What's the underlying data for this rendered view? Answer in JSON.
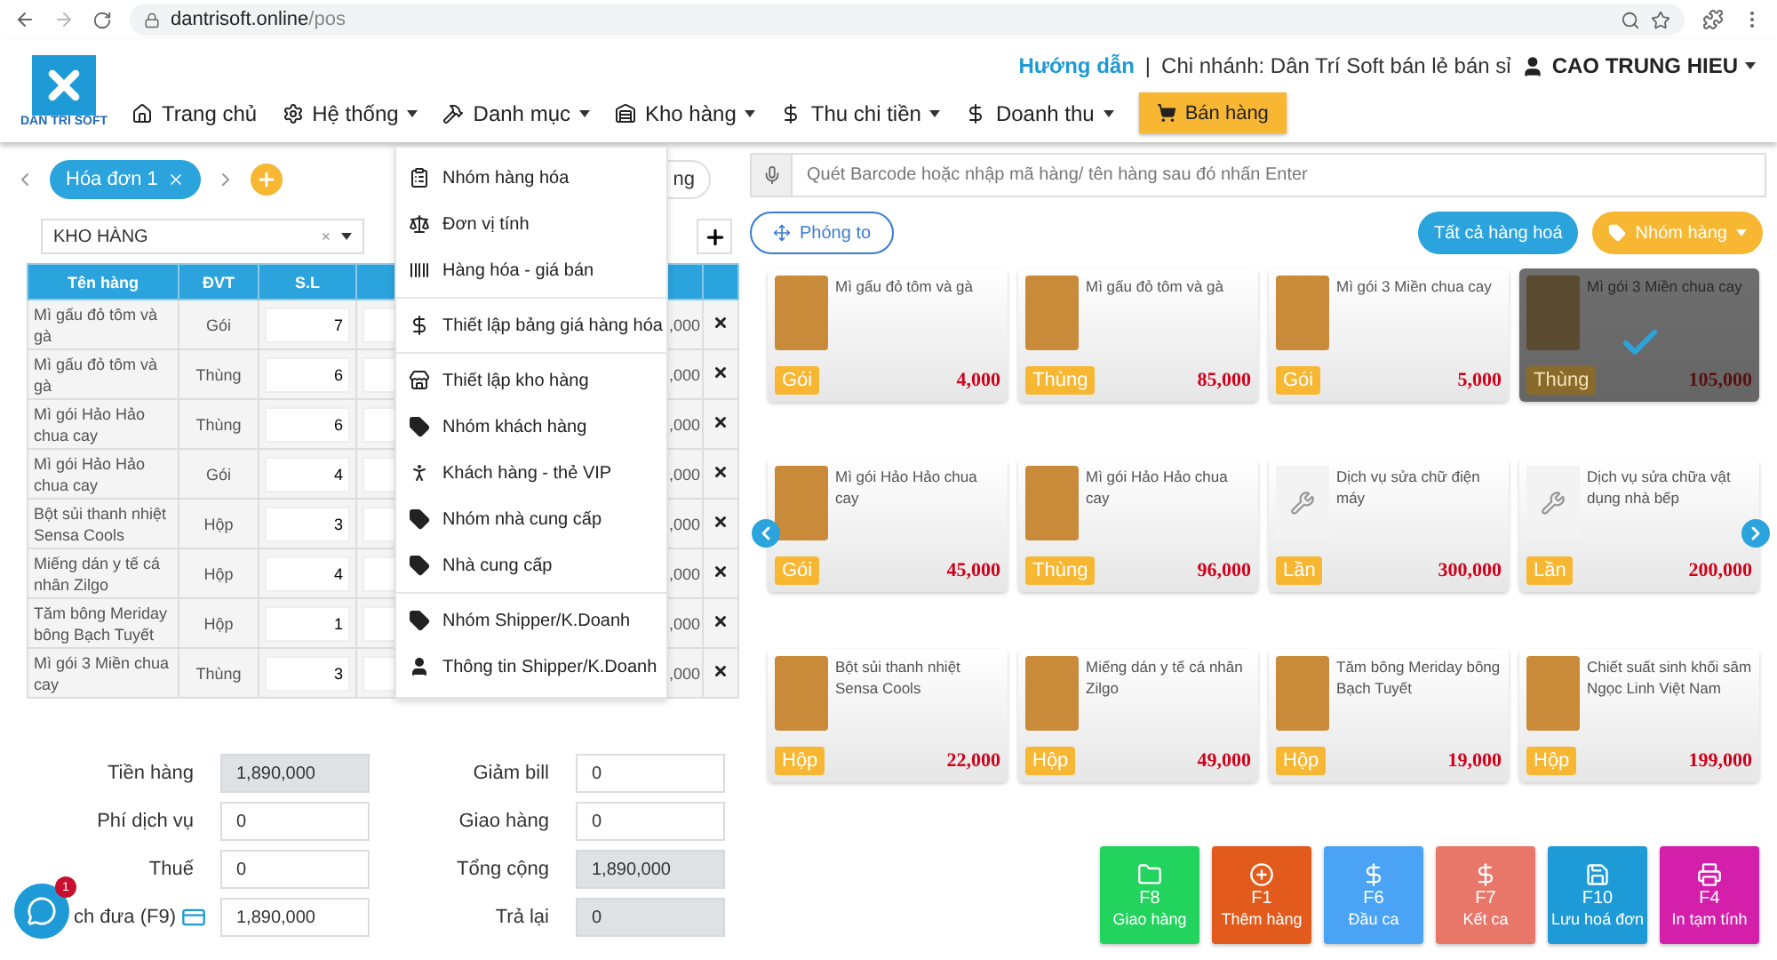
{
  "browser": {
    "url_host": "dantrisoft.online",
    "url_path": "/pos"
  },
  "header": {
    "logo_text": "DAN TRI SOFT",
    "guide_link": "Hướng dẫn",
    "separator": "|",
    "branch": "Chi nhánh: Dân Trí Soft bán lẻ bán sỉ",
    "user": "CAO TRUNG HIEU",
    "nav": [
      {
        "label": "Trang chủ",
        "dropdown": false
      },
      {
        "label": "Hệ thống",
        "dropdown": true
      },
      {
        "label": "Danh mục",
        "dropdown": true
      },
      {
        "label": "Kho hàng",
        "dropdown": true
      },
      {
        "label": "Thu chi tiền",
        "dropdown": true
      },
      {
        "label": "Doanh thu",
        "dropdown": true
      }
    ],
    "sell_button": "Bán hàng"
  },
  "menu": {
    "groups": [
      [
        {
          "label": "Nhóm hàng hóa"
        },
        {
          "label": "Đơn vị tính"
        },
        {
          "label": "Hàng hóa - giá bán"
        }
      ],
      [
        {
          "label": "Thiết lập bảng giá hàng hóa"
        }
      ],
      [
        {
          "label": "Thiết lập kho hàng"
        },
        {
          "label": "Nhóm khách hàng"
        },
        {
          "label": "Khách hàng - thẻ VIP"
        },
        {
          "label": "Nhóm nhà cung cấp"
        },
        {
          "label": "Nhà cung cấp"
        }
      ],
      [
        {
          "label": "Nhóm Shipper/K.Doanh"
        },
        {
          "label": "Thông tin Shipper/K.Doanh"
        }
      ]
    ]
  },
  "invoice_tabs": [
    {
      "label": "Hóa đơn 1",
      "selected": true
    }
  ],
  "partial_button": "ng",
  "warehouse_select": {
    "value": "KHO HÀNG",
    "clear": "×"
  },
  "table": {
    "columns": [
      "Tên hàng",
      "ĐVT",
      "S.L"
    ],
    "rows": [
      {
        "name": "Mì gấu đỏ tôm và gà",
        "unit": "Gói",
        "qty": "7",
        "column_5": ",000"
      },
      {
        "name": "Mì gấu đỏ tôm và gà",
        "unit": "Thùng",
        "qty": "6",
        "column_5": ",000"
      },
      {
        "name": "Mì gói Hảo Hảo chua cay",
        "unit": "Thùng",
        "qty": "6",
        "column_5": ",000"
      },
      {
        "name": "Mì gói Hảo Hảo chua cay",
        "unit": "Gói",
        "qty": "4",
        "column_5": ",000"
      },
      {
        "name": "Bột sủi thanh nhiệt Sensa Cools",
        "unit": "Hộp",
        "qty": "3",
        "column_5": ",000"
      },
      {
        "name": "Miếng dán y tế cá nhân Zilgo",
        "unit": "Hộp",
        "qty": "4",
        "column_5": ",000"
      },
      {
        "name": "Tăm bông Meriday bông Bạch Tuyết",
        "unit": "Hộp",
        "qty": "1",
        "column_5": ",000"
      },
      {
        "name": "Mì gói 3 Miền chua cay",
        "unit": "Thùng",
        "qty": "3",
        "column_5": ",000"
      }
    ]
  },
  "summary": {
    "left": [
      {
        "label": "Tiền hàng",
        "value": "1,890,000",
        "disabled": true
      },
      {
        "label": "Phí dịch vụ",
        "value": "0",
        "disabled": false
      },
      {
        "label": "Thuế",
        "value": "0",
        "disabled": false
      },
      {
        "label": "ch đưa (F9)",
        "value": "1,890,000",
        "disabled": false
      }
    ],
    "right": [
      {
        "label": "Giảm bill",
        "value": "0",
        "disabled": false
      },
      {
        "label": "Giao hàng",
        "value": "0",
        "disabled": false
      },
      {
        "label": "Tổng cộng",
        "value": "1,890,000",
        "disabled": true
      },
      {
        "label": "Trả lại",
        "value": "0",
        "disabled": true
      }
    ]
  },
  "chat": {
    "badge": "1"
  },
  "search": {
    "placeholder": "Quét Barcode hoặc nhập mã hàng/ tên hàng sau đó nhấn Enter"
  },
  "zoom_button": "Phóng to",
  "all_products_button": "Tất cả hàng hoá",
  "group_button": "Nhóm hàng",
  "products": [
    {
      "name": "Mì gấu đỏ tôm và gà",
      "unit": "Gói",
      "price": "4,000",
      "kind": "photo",
      "selected": false
    },
    {
      "name": "Mì gấu đỏ tôm và gà",
      "unit": "Thùng",
      "price": "85,000",
      "kind": "photo",
      "selected": false
    },
    {
      "name": "Mì gói 3 Miền chua cay",
      "unit": "Gói",
      "price": "5,000",
      "kind": "photo",
      "selected": false
    },
    {
      "name": "Mì gói 3 Miền chua cay",
      "unit": "Thùng",
      "price": "105,000",
      "kind": "photo",
      "selected": true
    },
    {
      "name": "Mì gói Hảo Hảo chua cay",
      "unit": "Gói",
      "price": "45,000",
      "kind": "photo",
      "selected": false
    },
    {
      "name": "Mì gói Hảo Hảo chua cay",
      "unit": "Thùng",
      "price": "96,000",
      "kind": "photo",
      "selected": false
    },
    {
      "name": "Dịch vụ sửa chữ điện máy",
      "unit": "Lần",
      "price": "300,000",
      "kind": "service",
      "selected": false
    },
    {
      "name": "Dịch vụ sửa chữa vật dụng nhà bếp",
      "unit": "Lần",
      "price": "200,000",
      "kind": "service",
      "selected": false
    },
    {
      "name": "Bột sủi thanh nhiệt Sensa Cools",
      "unit": "Hộp",
      "price": "22,000",
      "kind": "photo",
      "selected": false
    },
    {
      "name": "Miếng dán y tế cá nhân Zilgo",
      "unit": "Hộp",
      "price": "49,000",
      "kind": "photo",
      "selected": false
    },
    {
      "name": "Tăm bông Meriday bông Bạch Tuyết",
      "unit": "Hộp",
      "price": "19,000",
      "kind": "photo",
      "selected": false
    },
    {
      "name": "Chiết suất sinh khối sâm Ngọc Linh Việt Nam",
      "unit": "Hộp",
      "price": "199,000",
      "kind": "photo",
      "selected": false
    }
  ],
  "actions": [
    {
      "key": "F8",
      "label": "Giao hàng",
      "color": "#22d35e"
    },
    {
      "key": "F1",
      "label": "Thêm hàng",
      "color": "#e25a1c"
    },
    {
      "key": "F6",
      "label": "Đầu ca",
      "color": "#4aa3f5"
    },
    {
      "key": "F7",
      "label": "Kết ca",
      "color": "#e8776a"
    },
    {
      "key": "F10",
      "label": "Lưu hoá đơn",
      "color": "#1e9ad6"
    },
    {
      "key": "F4",
      "label": "In tạm tính",
      "color": "#d41fab"
    }
  ]
}
